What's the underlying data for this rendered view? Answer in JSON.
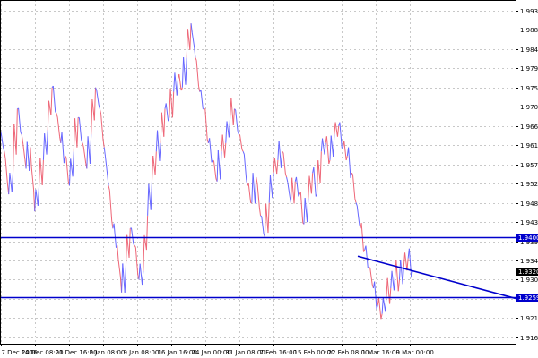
{
  "chart_data": {
    "type": "line",
    "title": "",
    "xlabel": "",
    "ylabel": "",
    "ylim": [
      1.915,
      1.9955
    ],
    "grid": true,
    "y_ticks": [
      "1.9930",
      "1.9885",
      "1.9840",
      "1.9795",
      "1.9750",
      "1.9705",
      "1.9660",
      "1.9615",
      "1.9570",
      "1.9525",
      "1.9480",
      "1.9435",
      "1.9390",
      "1.9345",
      "1.9300",
      "1.9255",
      "1.9210",
      "1.9165"
    ],
    "x_ticks": [
      "7 Dec 2006",
      "14 Dec 08:00",
      "21 Dec 16:00",
      "2 Jan 08:00",
      "9 Jan 08:00",
      "16 Jan 16:00",
      "24 Jan 00:00",
      "31 Jan 08:00",
      "7 Feb 16:00",
      "15 Feb 00:00",
      "22 Feb 08:00",
      "1 Mar 16:00",
      "9 Mar 00:00"
    ],
    "series": [
      {
        "values": [
          1.965,
          1.96,
          1.95,
          1.955,
          1.97,
          1.964,
          1.956,
          1.961,
          1.946,
          1.952,
          1.958,
          1.965,
          1.975,
          1.969,
          1.962,
          1.959,
          1.952,
          1.96,
          1.968,
          1.962,
          1.956,
          1.964,
          1.975,
          1.97,
          1.961,
          1.952,
          1.942,
          1.938,
          1.927,
          1.933,
          1.942,
          1.938,
          1.93,
          1.932,
          1.945,
          1.953,
          1.96,
          1.962,
          1.97,
          1.968,
          1.974,
          1.977,
          1.975,
          1.982,
          1.99,
          1.982,
          1.974,
          1.97,
          1.962,
          1.958,
          1.953,
          1.96,
          1.962,
          1.968,
          1.97,
          1.964,
          1.96,
          1.952,
          1.948,
          1.954,
          1.945,
          1.94,
          1.948,
          1.955,
          1.958,
          1.96,
          1.954,
          1.948,
          1.953,
          1.95,
          1.943,
          1.949,
          1.955,
          1.95,
          1.96,
          1.962,
          1.958,
          1.964,
          1.966,
          1.961,
          1.959,
          1.955,
          1.948,
          1.942,
          1.937,
          1.933,
          1.928,
          1.924,
          1.922,
          1.926,
          1.928,
          1.931,
          1.93,
          1.933,
          1.935,
          1.932
        ],
        "level_tag": "1.9320",
        "color": "#6666ff",
        "color_alt": "#ee6677"
      }
    ],
    "horizontal_levels": [
      {
        "value": 1.94,
        "label": "1.9400",
        "color": "#0000cc"
      },
      {
        "value": 1.9259,
        "label": "1.9259",
        "color": "#0000cc"
      }
    ],
    "trendline": {
      "from": [
        "1 Mar 16:00",
        1.9355
      ],
      "to": [
        "9 Mar 00:00",
        1.9256
      ],
      "color": "#0000cc"
    }
  }
}
